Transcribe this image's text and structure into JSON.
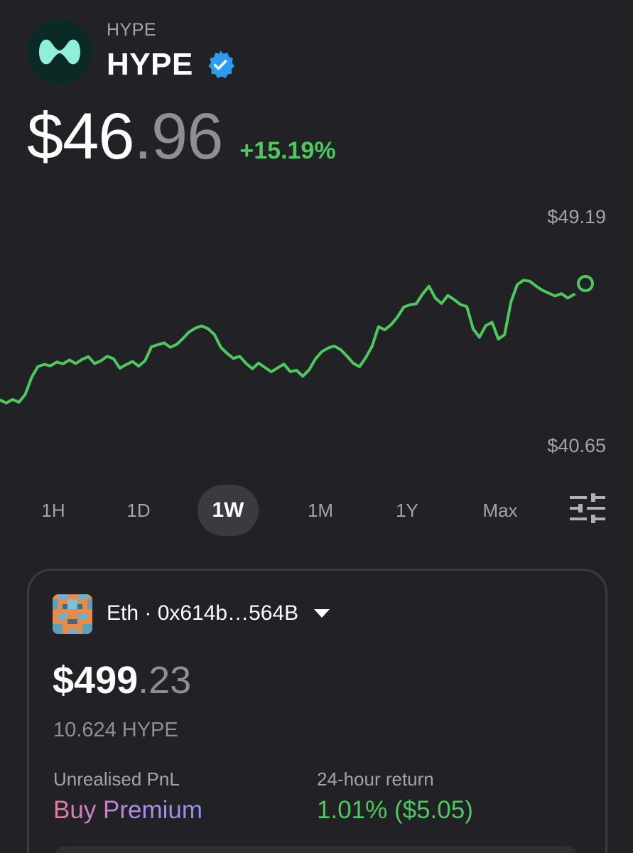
{
  "asset": {
    "ticker_small": "HYPE",
    "name": "HYPE",
    "price_whole": "$46",
    "price_decimal": ".96",
    "change": "+15.19%",
    "accent_color": "#4cc95c",
    "logo_color": "#8ef0d9",
    "verified_icon": "verified-badge-icon"
  },
  "chart_data": {
    "type": "line",
    "max_label": "$49.19",
    "min_label": "$40.65",
    "ylim": [
      40.65,
      49.19
    ],
    "series": [
      {
        "values": [
          42.45,
          42.33,
          42.47,
          42.36,
          42.66,
          43.32,
          43.74,
          43.83,
          43.77,
          43.92,
          43.85,
          44.0,
          43.86,
          44.02,
          44.13,
          43.86,
          43.97,
          44.14,
          44.05,
          43.68,
          43.82,
          43.94,
          43.76,
          43.97,
          44.51,
          44.59,
          44.66,
          44.49,
          44.6,
          44.83,
          45.09,
          45.24,
          45.32,
          45.21,
          44.98,
          44.49,
          44.26,
          44.06,
          44.14,
          43.87,
          43.66,
          43.88,
          43.71,
          43.54,
          43.69,
          43.84,
          43.55,
          43.6,
          43.37,
          43.62,
          44.04,
          44.32,
          44.46,
          44.54,
          44.4,
          44.15,
          43.87,
          43.74,
          44.1,
          44.54,
          45.29,
          45.17,
          45.37,
          45.66,
          46.05,
          46.14,
          46.18,
          46.56,
          46.86,
          46.4,
          46.19,
          46.5,
          46.34,
          46.15,
          46.07,
          45.21,
          44.88,
          45.33,
          45.46,
          44.81,
          44.98,
          46.25,
          46.92,
          47.09,
          47.05,
          46.86,
          46.7,
          46.59,
          46.48,
          46.57,
          46.4,
          46.54
        ]
      }
    ],
    "current_value": 46.96,
    "line_color": "#4cc95c"
  },
  "ranges": [
    {
      "label": "1H",
      "active": false
    },
    {
      "label": "1D",
      "active": false
    },
    {
      "label": "1W",
      "active": true
    },
    {
      "label": "1M",
      "active": false
    },
    {
      "label": "1Y",
      "active": false
    },
    {
      "label": "Max",
      "active": false
    }
  ],
  "wallet": {
    "selector": "Eth · 0x614b…564B",
    "balance_whole": "$499",
    "balance_decimal": ".23",
    "holding": "10.624 HYPE",
    "pnl_label": "Unrealised PnL",
    "pnl_value": "Buy Premium",
    "return_label": "24-hour return",
    "return_value": "1.01% ($5.05)"
  }
}
